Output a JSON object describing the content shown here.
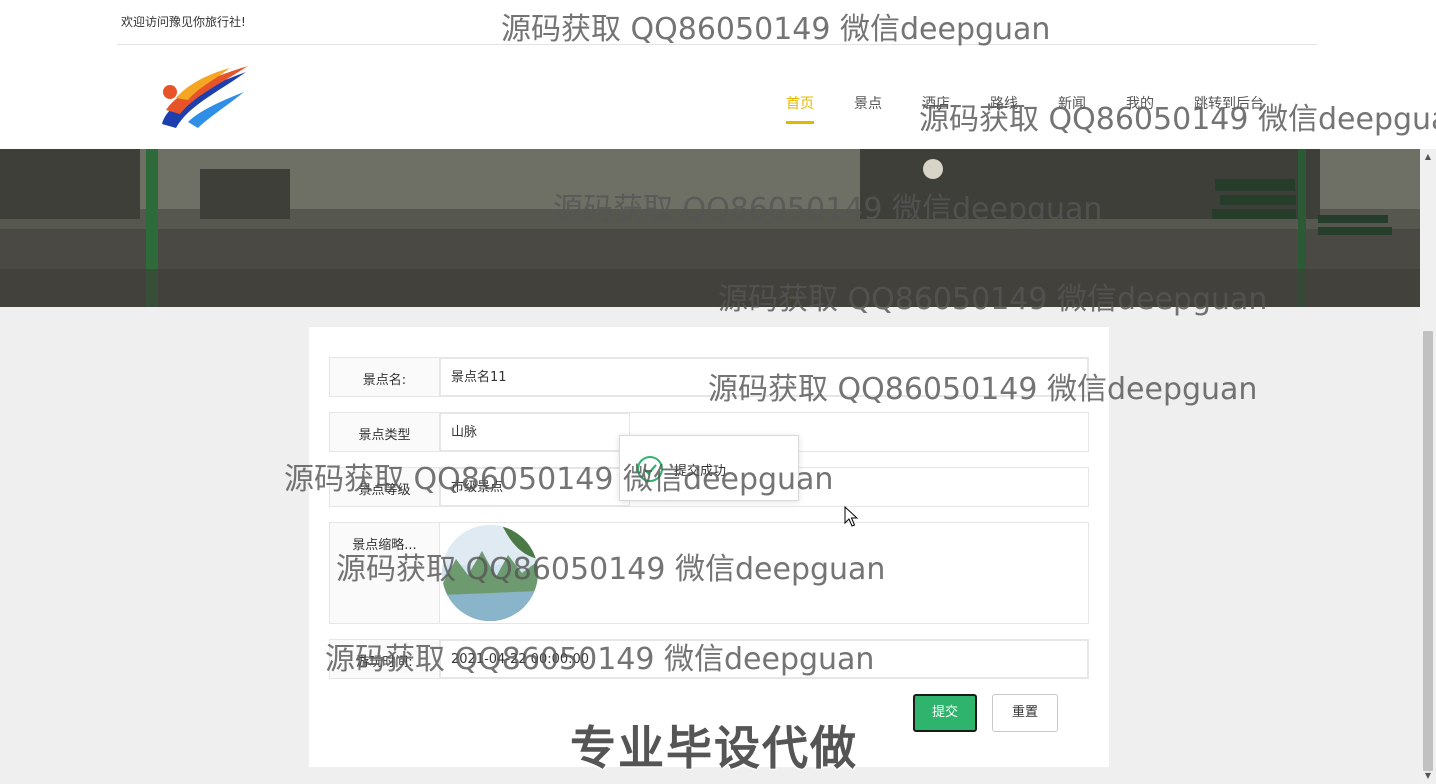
{
  "header": {
    "welcome_text": "欢迎访问豫见你旅行社!",
    "nav": [
      {
        "label": "首页",
        "active": true
      },
      {
        "label": "景点"
      },
      {
        "label": "酒店"
      },
      {
        "label": "路线"
      },
      {
        "label": "新闻"
      },
      {
        "label": "我的"
      },
      {
        "label": "跳转到后台"
      }
    ]
  },
  "form": {
    "name_label": "景点名:",
    "name_value": "景点名11",
    "type_label": "景点类型",
    "type_value": "山脉",
    "level_label": "景点等级",
    "level_value": "市级景点",
    "thumb_label": "景点缩略...",
    "time_label": "游玩时间:",
    "time_value": "2021-04-22 00:00:00",
    "submit_label": "提交",
    "reset_label": "重置"
  },
  "toast": {
    "message": "提交成功"
  },
  "watermarks": [
    "源码获取 QQ86050149 微信deepguan",
    "源码获取 QQ86050149 微信deepgua",
    "源码获取 QQ86050149 微信deepguan",
    "源码获取 QQ86050149 微信deepguan",
    "源码获取 QQ86050149 微信deepguan",
    "源码获取 QQ86050149 微信deepguan",
    "源码获取 QQ86050149 微信deepguan",
    "源码获取 QQ86050149 微信deepguan"
  ],
  "slogan": "专业毕设代做",
  "colors": {
    "nav_active": "#e4b800",
    "submit_bg": "#2fb46e",
    "page_bg": "#efefef"
  }
}
